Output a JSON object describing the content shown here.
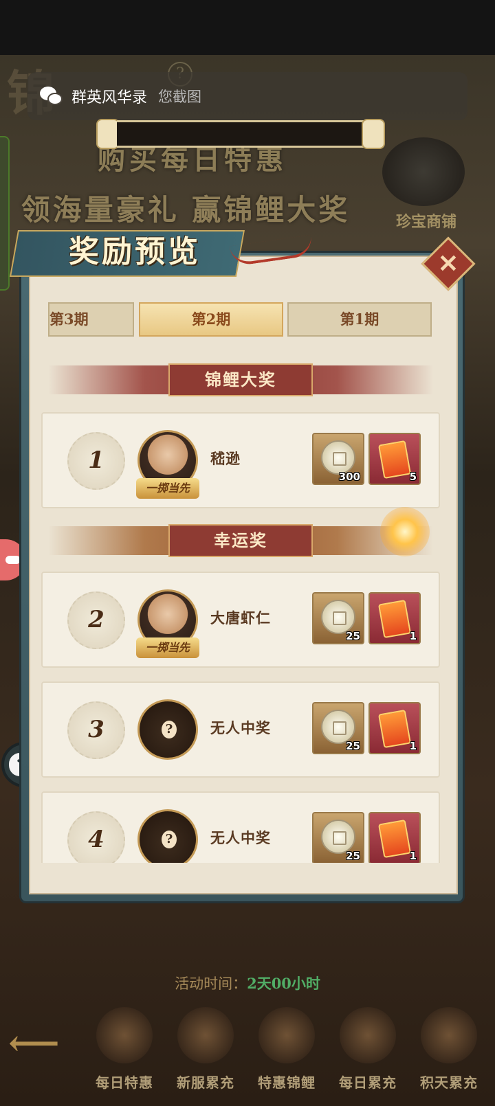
{
  "share_bar": {
    "app_name": "群英风华录",
    "subtitle": "您截图"
  },
  "background": {
    "banner_line1": "购买每日特惠",
    "banner_line2": "领海量豪礼 赢锦鲤大奖",
    "shop_label": "珍宝商铺",
    "help_icon": "?"
  },
  "modal": {
    "title": "奖励预览",
    "close_icon": "✕",
    "tabs": [
      {
        "label": "第3期",
        "active": false
      },
      {
        "label": "第2期",
        "active": true
      },
      {
        "label": "第1期",
        "active": false
      }
    ],
    "sections": {
      "grand": "锦鲤大奖",
      "lucky": "幸运奖"
    },
    "rows": [
      {
        "rank": "1",
        "name": "嵇逊",
        "vip": "一掷当先",
        "has_avatar": true,
        "rewards": [
          {
            "icon": "coin-icon",
            "qty": "300"
          },
          {
            "icon": "red-envelope-icon",
            "qty": "5"
          }
        ]
      },
      {
        "rank": "2",
        "name": "大唐虾仁",
        "vip": "一掷当先",
        "has_avatar": true,
        "rewards": [
          {
            "icon": "coin-icon",
            "qty": "25"
          },
          {
            "icon": "red-envelope-icon",
            "qty": "1"
          }
        ]
      },
      {
        "rank": "3",
        "name": "无人中奖",
        "unknown_mark": "?",
        "has_avatar": false,
        "rewards": [
          {
            "icon": "coin-icon",
            "qty": "25"
          },
          {
            "icon": "red-envelope-icon",
            "qty": "1"
          }
        ]
      },
      {
        "rank": "4",
        "name": "无人中奖",
        "unknown_mark": "?",
        "has_avatar": false,
        "rewards": [
          {
            "icon": "coin-icon",
            "qty": "25"
          },
          {
            "icon": "red-envelope-icon",
            "qty": "1"
          }
        ]
      }
    ]
  },
  "bottom": {
    "time_label": "活动时间：",
    "time_value": "2天00小时",
    "nav": [
      {
        "label": "每日特惠",
        "icon": "daily-deal-icon"
      },
      {
        "label": "新服累充",
        "icon": "new-server-topup-icon"
      },
      {
        "label": "特惠锦鲤",
        "icon": "koi-icon"
      },
      {
        "label": "每日累充",
        "icon": "daily-topup-icon"
      },
      {
        "label": "积天累充",
        "icon": "accum-days-topup-icon"
      }
    ]
  },
  "colors": {
    "accent": "#8e3b33",
    "tab_active": "#e8c883",
    "frame": "#3a555c"
  }
}
